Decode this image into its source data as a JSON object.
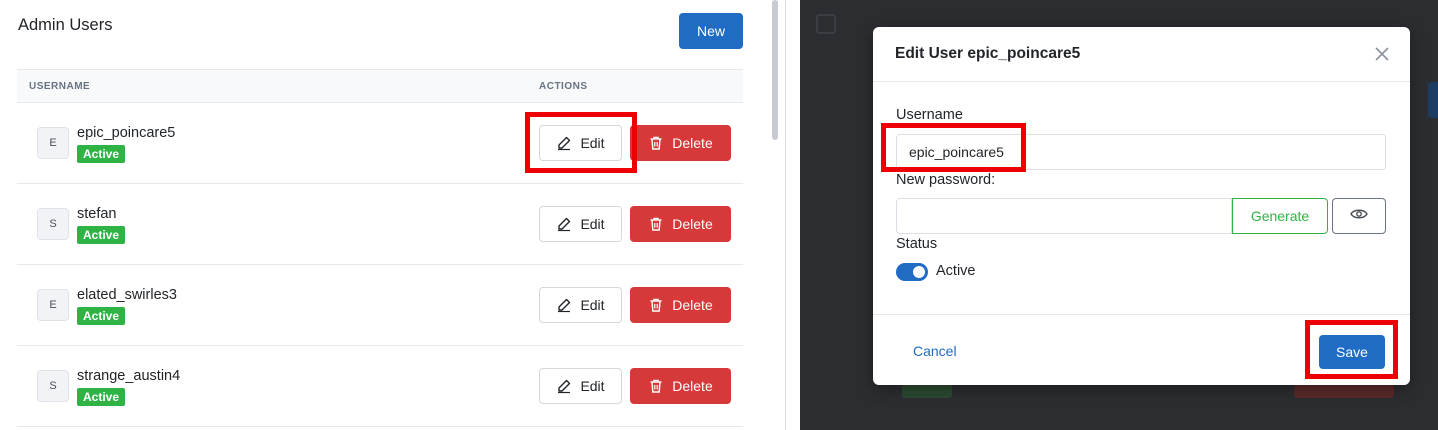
{
  "left": {
    "title": "Admin Users",
    "new_label": "New",
    "columns": {
      "username": "USERNAME",
      "actions": "ACTIONS"
    },
    "edit_label": "Edit",
    "delete_label": "Delete",
    "rows": [
      {
        "initial": "E",
        "username": "epic_poincare5",
        "status": "Active"
      },
      {
        "initial": "S",
        "username": "stefan",
        "status": "Active"
      },
      {
        "initial": "E",
        "username": "elated_swirles3",
        "status": "Active"
      },
      {
        "initial": "S",
        "username": "strange_austin4",
        "status": "Active"
      }
    ]
  },
  "modal": {
    "title": "Edit User epic_poincare5",
    "username_label": "Username",
    "username_value": "epic_poincare5",
    "password_label": "New password:",
    "password_value": "",
    "generate_label": "Generate",
    "status_label": "Status",
    "status_toggle_label": "Active",
    "status_on": true,
    "cancel_label": "Cancel",
    "save_label": "Save"
  },
  "colors": {
    "primary": "#206bc4",
    "success": "#2fb344",
    "danger": "#d63939",
    "highlight": "#ee0000"
  },
  "icons": {
    "edit": "pencil-square-icon",
    "delete": "trash-icon",
    "close": "close-icon",
    "reveal": "eye-icon"
  }
}
